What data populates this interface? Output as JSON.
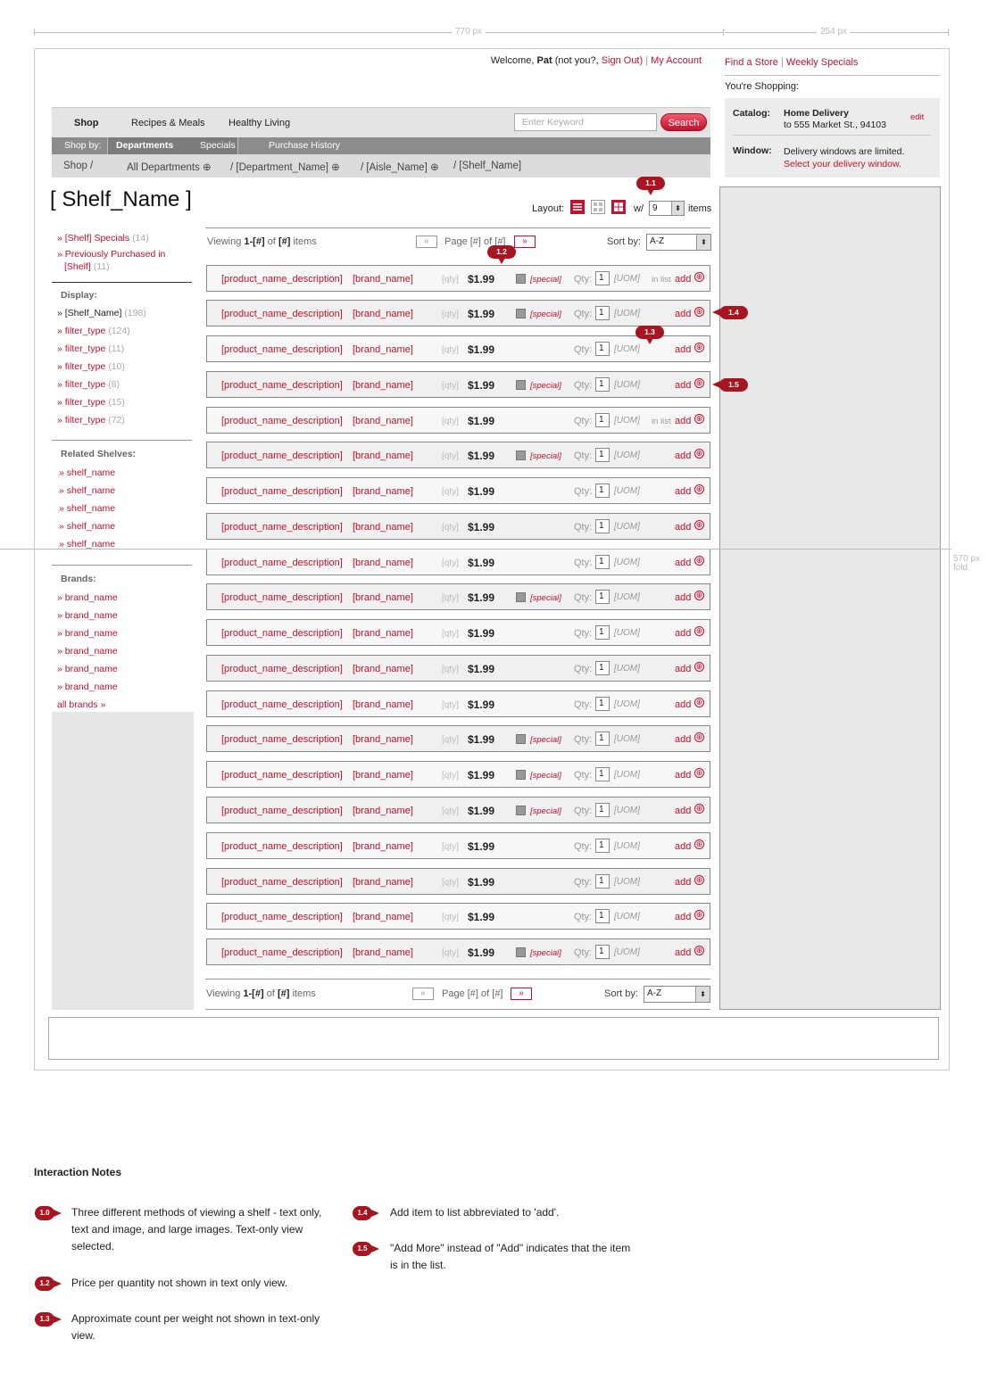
{
  "rulers": {
    "main_width": "770 px",
    "rail_width": "254 px",
    "fold": "570 px",
    "fold_sub": "fold"
  },
  "header": {
    "welcome_prefix": "Welcome,",
    "user": "Pat",
    "not_you": "(not you?,",
    "sign_out": "Sign Out)",
    "sep": "|",
    "my_account": "My Account",
    "find_store": "Find a Store",
    "weekly_specials": "Weekly Specials",
    "youre_shopping": "You're Shopping:"
  },
  "nav": {
    "tabs": [
      "Shop",
      "Recipes & Meals",
      "Healthy Living"
    ],
    "search_placeholder": "Enter Keyword",
    "search_button": "Search",
    "shop_by": "Shop by:",
    "sub_items": [
      "Departments",
      "Specials",
      "Purchase History"
    ],
    "breadcrumb": [
      "Shop /",
      "All Departments ⊕",
      "/ [Department_Name] ⊕",
      "/ [Aisle_Name] ⊕",
      "/ [Shelf_Name]"
    ]
  },
  "catalog": {
    "catalog_label": "Catalog:",
    "delivery_title": "Home Delivery",
    "delivery_addr": "to 555 Market St., 94103",
    "edit": "edit",
    "window_label": "Window:",
    "window_note": "Delivery windows are limited.",
    "window_link": "Select your delivery window."
  },
  "shelf": {
    "title": "[ Shelf_Name ]",
    "layout_label": "Layout:",
    "with": "w/",
    "items_per": "9",
    "items_label": "items"
  },
  "sidebar": {
    "top_links": [
      {
        "label": "» [Shelf] Specials",
        "count": "(14)"
      },
      {
        "label": "» Previously Purchased in",
        "count": ""
      },
      {
        "label": "[Shelf]",
        "count": "(11)"
      }
    ],
    "display_heading": "Display:",
    "display_items": [
      {
        "label": "» [Shelf_Name]",
        "count": "(198)"
      },
      {
        "label": "» filter_type",
        "count": "(124)"
      },
      {
        "label": "» filter_type",
        "count": "(11)"
      },
      {
        "label": "» filter_type",
        "count": "(10)"
      },
      {
        "label": "» filter_type",
        "count": "(8)"
      },
      {
        "label": "» filter_type",
        "count": "(15)"
      },
      {
        "label": "» filter_type",
        "count": "(72)"
      }
    ],
    "related_heading": "Related Shelves:",
    "related_items": [
      "» shelf_name",
      "» shelf_name",
      "» shelf_name",
      "» shelf_name",
      "» shelf_name"
    ],
    "brands_heading": "Brands:",
    "brand_items": [
      "» brand_name",
      "» brand_name",
      "» brand_name",
      "» brand_name",
      "» brand_name",
      "» brand_name"
    ],
    "all_brands": "all brands »"
  },
  "listing": {
    "viewing_prefix": "Viewing",
    "viewing_range": "1-[#]",
    "viewing_of": "of",
    "viewing_total": "[#]",
    "viewing_suffix": "items",
    "prev": "«",
    "page_text": "Page [#] of [#]",
    "next": "»",
    "sort_label": "Sort by:",
    "sort_value": "A-Z"
  },
  "row_template": {
    "name": "[product_name_description]",
    "brand": "[brand_name]",
    "qty": "[qty]",
    "price": "$1.99",
    "special": "[special]",
    "qty_label": "Qty:",
    "qty_value": "1",
    "uom": "[UOM]",
    "in_list": "in list",
    "add": "add",
    "add_icon": "⊕"
  },
  "rows": [
    {
      "special": true,
      "in_list": true
    },
    {
      "special": true,
      "in_list": false
    },
    {
      "special": false,
      "in_list": false
    },
    {
      "special": true,
      "in_list": false
    },
    {
      "special": false,
      "in_list": true
    },
    {
      "special": true,
      "in_list": false
    },
    {
      "special": false,
      "in_list": false
    },
    {
      "special": false,
      "in_list": false
    },
    {
      "special": false,
      "in_list": false
    },
    {
      "special": true,
      "in_list": false
    },
    {
      "special": false,
      "in_list": false
    },
    {
      "special": false,
      "in_list": false
    },
    {
      "special": false,
      "in_list": false
    },
    {
      "special": true,
      "in_list": false
    },
    {
      "special": true,
      "in_list": false
    },
    {
      "special": true,
      "in_list": false
    },
    {
      "special": false,
      "in_list": false
    },
    {
      "special": false,
      "in_list": false
    },
    {
      "special": false,
      "in_list": false
    },
    {
      "special": true,
      "in_list": false
    }
  ],
  "markers": [
    "1.1",
    "1.2",
    "1.3",
    "1.4",
    "1.5"
  ],
  "notes": {
    "title": "Interaction Notes",
    "items": [
      {
        "badge": "1.0",
        "text": "Three different methods of viewing a shelf - text only, text and image, and large images. Text-only view selected."
      },
      {
        "badge": "1.2",
        "text": "Price per quantity not shown in text only view."
      },
      {
        "badge": "1.3",
        "text": "Approximate count per weight not shown in text-only view."
      },
      {
        "badge": "1.4",
        "text": "Add item to list abbreviated to 'add'."
      },
      {
        "badge": "1.5",
        "text": "\"Add More\" instead of \"Add\" indicates that the item is in the list."
      }
    ]
  },
  "colors": {
    "accent": "#c4102c",
    "marker": "#a8141f",
    "nav_grey": "#8c8c8c"
  }
}
